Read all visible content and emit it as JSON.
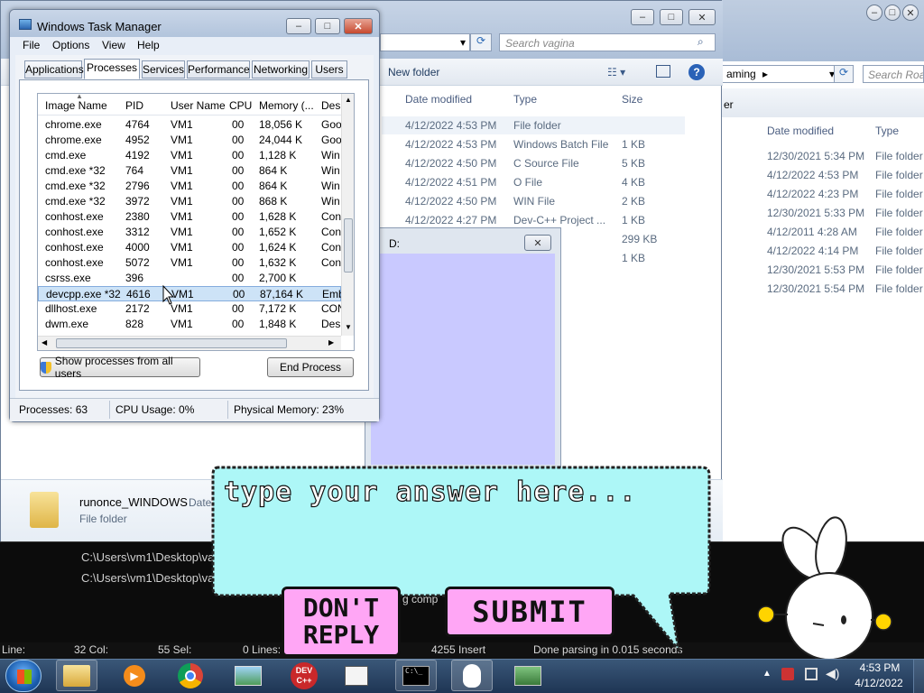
{
  "task_manager": {
    "title": "Windows Task Manager",
    "menu": [
      "File",
      "Options",
      "View",
      "Help"
    ],
    "tabs": [
      "Applications",
      "Processes",
      "Services",
      "Performance",
      "Networking",
      "Users"
    ],
    "columns": [
      "Image Name",
      "PID",
      "User Name",
      "CPU",
      "Memory (...",
      "Des"
    ],
    "rows": [
      [
        "chrome.exe",
        "4764",
        "VM1",
        "00",
        "18,056 K",
        "Goo"
      ],
      [
        "chrome.exe",
        "4952",
        "VM1",
        "00",
        "24,044 K",
        "Goo"
      ],
      [
        "cmd.exe",
        "4192",
        "VM1",
        "00",
        "1,128 K",
        "Win"
      ],
      [
        "cmd.exe *32",
        "764",
        "VM1",
        "00",
        "864 K",
        "Win"
      ],
      [
        "cmd.exe *32",
        "2796",
        "VM1",
        "00",
        "864 K",
        "Win"
      ],
      [
        "cmd.exe *32",
        "3972",
        "VM1",
        "00",
        "868 K",
        "Win"
      ],
      [
        "conhost.exe",
        "2380",
        "VM1",
        "00",
        "1,628 K",
        "Con"
      ],
      [
        "conhost.exe",
        "3312",
        "VM1",
        "00",
        "1,652 K",
        "Con"
      ],
      [
        "conhost.exe",
        "4000",
        "VM1",
        "00",
        "1,624 K",
        "Con"
      ],
      [
        "conhost.exe",
        "5072",
        "VM1",
        "00",
        "1,632 K",
        "Con"
      ],
      [
        "csrss.exe",
        "396",
        "",
        "00",
        "2,700 K",
        ""
      ],
      [
        "devcpp.exe *32",
        "4616",
        "VM1",
        "00",
        "87,164 K",
        "Emb"
      ],
      [
        "dllhost.exe",
        "2172",
        "VM1",
        "00",
        "7,172 K",
        "CON"
      ],
      [
        "dwm.exe",
        "828",
        "VM1",
        "00",
        "1,848 K",
        "Des"
      ]
    ],
    "selected_row": 11,
    "show_all_label": "Show processes from all users",
    "end_process_label": "End Process",
    "status": {
      "processes": "Processes: 63",
      "cpu": "CPU Usage: 0%",
      "memory": "Physical Memory: 23%"
    }
  },
  "explorer_back": {
    "search_placeholder": "Search vagina",
    "new_folder": "New folder",
    "columns": [
      "Date modified",
      "Type",
      "Size"
    ],
    "rows": [
      [
        "4/12/2022 4:53 PM",
        "File folder",
        ""
      ],
      [
        "4/12/2022 4:53 PM",
        "Windows Batch File",
        "1 KB"
      ],
      [
        "4/12/2022 4:50 PM",
        "C Source File",
        "5 KB"
      ],
      [
        "4/12/2022 4:51 PM",
        "O File",
        "4 KB"
      ],
      [
        "4/12/2022 4:50 PM",
        "WIN File",
        "2 KB"
      ],
      [
        "4/12/2022 4:27 PM",
        "Dev-C++ Project ...",
        "1 KB"
      ],
      [
        "",
        "n",
        "299 KB"
      ],
      [
        "",
        "ile",
        "1 KB"
      ]
    ],
    "details_name": "runonce_WINDOWS",
    "details_date": "Date",
    "details_type": "File folder"
  },
  "explorer_right": {
    "breadcrumb": "aming",
    "search_placeholder": "Search Roar",
    "header_left": "er",
    "columns": [
      "Date modified",
      "Type"
    ],
    "rows": [
      [
        "12/30/2021 5:34 PM",
        "File folder"
      ],
      [
        "4/12/2022 4:53 PM",
        "File folder"
      ],
      [
        "4/12/2022 4:23 PM",
        "File folder"
      ],
      [
        "12/30/2021 5:33 PM",
        "File folder"
      ],
      [
        "4/12/2011 4:28 AM",
        "File folder"
      ],
      [
        "4/12/2022 4:14 PM",
        "File folder"
      ],
      [
        "12/30/2021 5:53 PM",
        "File folder"
      ],
      [
        "12/30/2021 5:54 PM",
        "File folder"
      ]
    ]
  },
  "bunny_window": {
    "title": "D:"
  },
  "speech": {
    "prompt": "type your answer here...",
    "dont_reply": "DON'T REPLY",
    "submit": "SUBMIT"
  },
  "console": {
    "lines": [
      "C:\\Users\\vm1\\Desktop\\va",
      "C:\\Users\\vm1\\Desktop\\va"
    ],
    "fragment": "g comp"
  },
  "devcpp_status": {
    "line": "Line:",
    "col": "32 Col:",
    "sel": "55 Sel:",
    "lines": "0 Lines:",
    "insert": "4255 Insert",
    "parsing": "Done parsing in 0.015 seconds"
  },
  "taskbar": {
    "time": "4:53 PM",
    "date": "4/12/2022",
    "devcpp_label_1": "DEV",
    "devcpp_label_2": "C++"
  },
  "colors": {
    "speech_bg": "#adf7f7",
    "button_bg": "#ffa6f5",
    "bunny_bg": "#c9c9ff",
    "taskbar": "#203a5c",
    "selection": "#cde3f7"
  }
}
